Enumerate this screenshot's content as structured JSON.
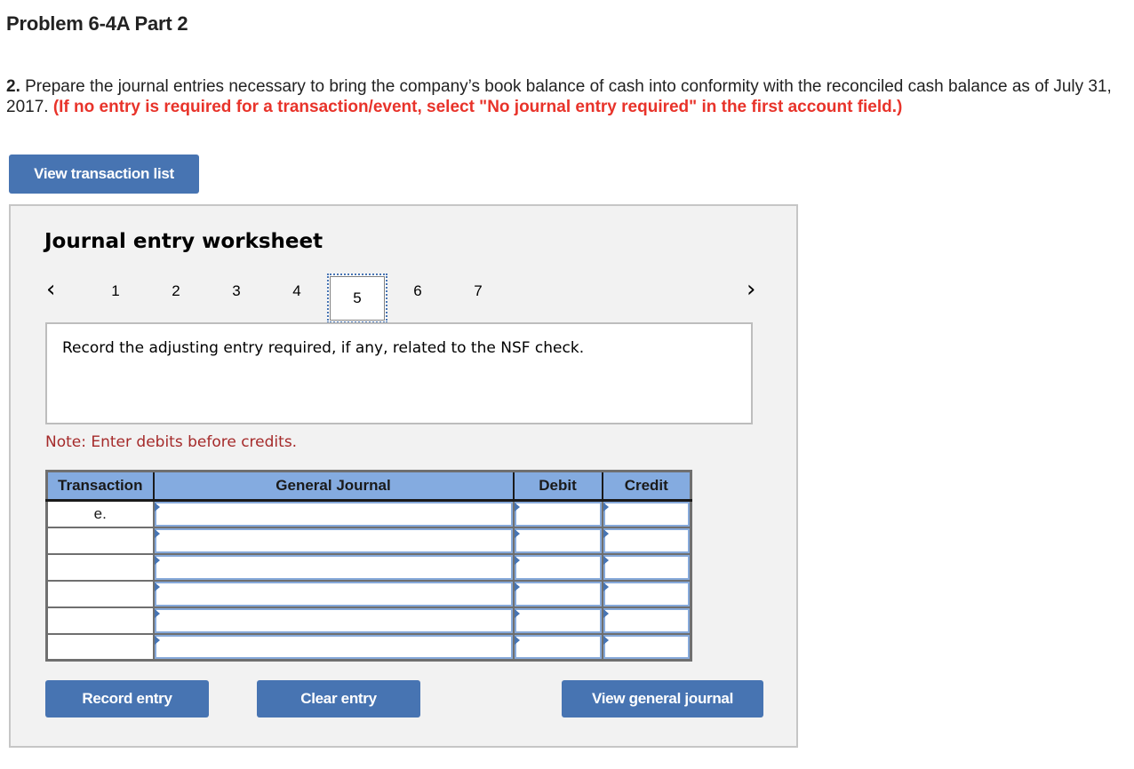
{
  "page": {
    "title": "Problem 6-4A Part 2",
    "instructions": {
      "number": "2.",
      "text": " Prepare the journal entries necessary to bring the company’s book balance of cash into conformity with the reconciled cash balance as of July 31, 2017. ",
      "requirement": "(If no entry is required for a transaction/event, select \"No journal entry required\" in the first account field.)"
    },
    "view_transaction_list_label": "View transaction list"
  },
  "worksheet": {
    "title": "Journal entry worksheet",
    "pager": {
      "prev_icon": "‹",
      "next_icon": "›",
      "pages": [
        "1",
        "2",
        "3",
        "4",
        "5",
        "6",
        "7"
      ],
      "active_page": "5"
    },
    "prompt": "Record the adjusting entry required, if any, related to the NSF check.",
    "note": "Note: Enter debits before credits.",
    "table": {
      "headers": [
        "Transaction",
        "General Journal",
        "Debit",
        "Credit"
      ],
      "rows": [
        {
          "transaction": "e.",
          "account": "",
          "debit": "",
          "credit": ""
        },
        {
          "transaction": "",
          "account": "",
          "debit": "",
          "credit": ""
        },
        {
          "transaction": "",
          "account": "",
          "debit": "",
          "credit": ""
        },
        {
          "transaction": "",
          "account": "",
          "debit": "",
          "credit": ""
        },
        {
          "transaction": "",
          "account": "",
          "debit": "",
          "credit": ""
        },
        {
          "transaction": "",
          "account": "",
          "debit": "",
          "credit": ""
        }
      ]
    },
    "buttons": {
      "record": "Record entry",
      "clear": "Clear entry",
      "view_general_journal": "View general journal"
    }
  },
  "colors": {
    "button_blue": "#4774b2",
    "header_blue": "#84abe0",
    "requirement_red": "#e8332a",
    "note_red": "#a52a2a",
    "panel_gray": "#f2f2f2"
  }
}
